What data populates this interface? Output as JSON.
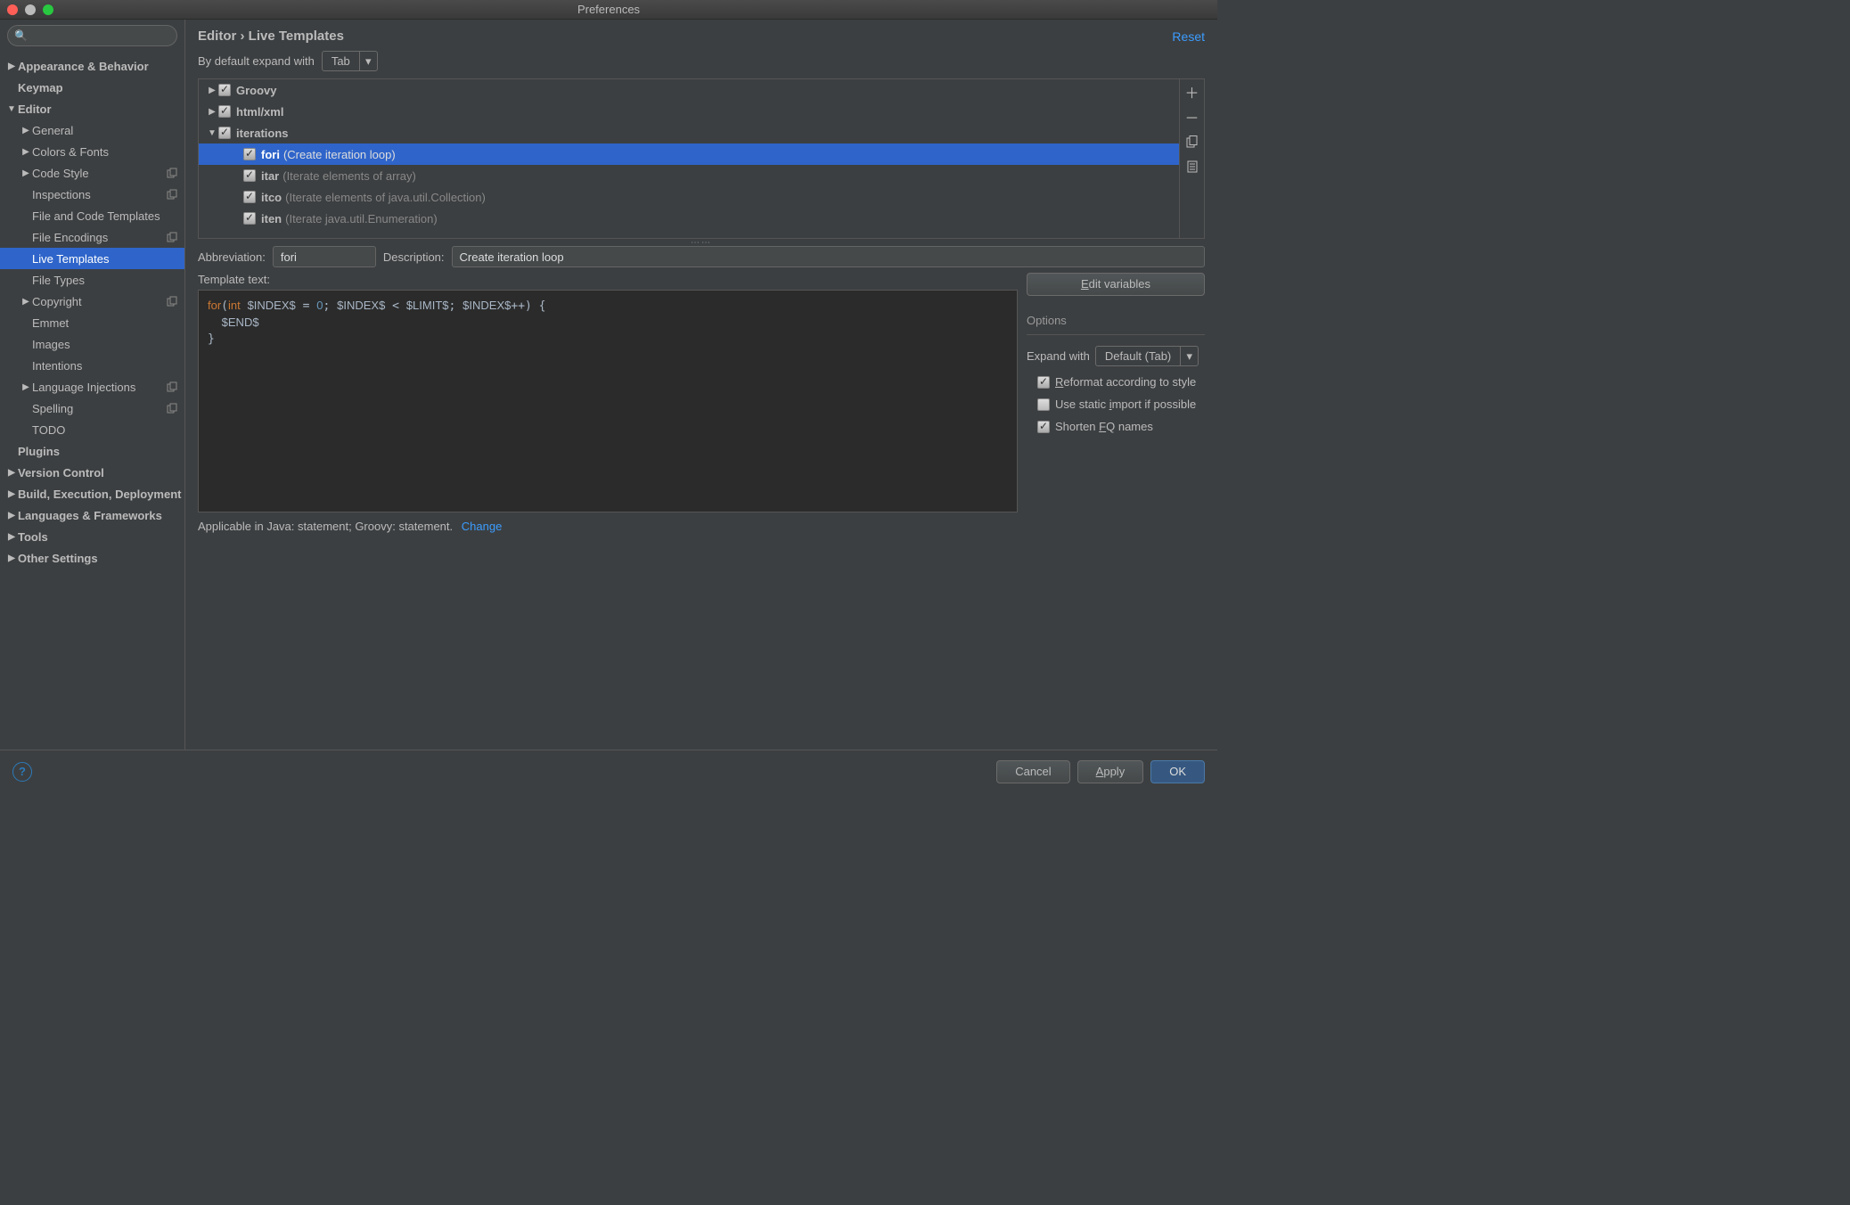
{
  "window": {
    "title": "Preferences"
  },
  "sidebar": {
    "search_placeholder": "",
    "items": [
      {
        "label": "Appearance & Behavior",
        "depth": 0,
        "caret": "right"
      },
      {
        "label": "Keymap",
        "depth": 0,
        "caret": "none"
      },
      {
        "label": "Editor",
        "depth": 0,
        "caret": "down"
      },
      {
        "label": "General",
        "depth": 1,
        "caret": "right"
      },
      {
        "label": "Colors & Fonts",
        "depth": 1,
        "caret": "right"
      },
      {
        "label": "Code Style",
        "depth": 1,
        "caret": "right",
        "suffix": true
      },
      {
        "label": "Inspections",
        "depth": 1,
        "caret": "none",
        "suffix": true
      },
      {
        "label": "File and Code Templates",
        "depth": 1,
        "caret": "none"
      },
      {
        "label": "File Encodings",
        "depth": 1,
        "caret": "none",
        "suffix": true
      },
      {
        "label": "Live Templates",
        "depth": 1,
        "caret": "none",
        "selected": true
      },
      {
        "label": "File Types",
        "depth": 1,
        "caret": "none"
      },
      {
        "label": "Copyright",
        "depth": 1,
        "caret": "right",
        "suffix": true
      },
      {
        "label": "Emmet",
        "depth": 1,
        "caret": "none"
      },
      {
        "label": "Images",
        "depth": 1,
        "caret": "none"
      },
      {
        "label": "Intentions",
        "depth": 1,
        "caret": "none"
      },
      {
        "label": "Language Injections",
        "depth": 1,
        "caret": "right",
        "suffix": true
      },
      {
        "label": "Spelling",
        "depth": 1,
        "caret": "none",
        "suffix": true
      },
      {
        "label": "TODO",
        "depth": 1,
        "caret": "none"
      },
      {
        "label": "Plugins",
        "depth": 0,
        "caret": "none"
      },
      {
        "label": "Version Control",
        "depth": 0,
        "caret": "right"
      },
      {
        "label": "Build, Execution, Deployment",
        "depth": 0,
        "caret": "right"
      },
      {
        "label": "Languages & Frameworks",
        "depth": 0,
        "caret": "right"
      },
      {
        "label": "Tools",
        "depth": 0,
        "caret": "right"
      },
      {
        "label": "Other Settings",
        "depth": 0,
        "caret": "right"
      }
    ]
  },
  "header": {
    "breadcrumb": "Editor › Live Templates",
    "reset": "Reset"
  },
  "expand": {
    "label": "By default expand with",
    "value": "Tab"
  },
  "template_groups": [
    {
      "label": "Groovy",
      "caret": "right",
      "checked": true
    },
    {
      "label": "html/xml",
      "caret": "right",
      "checked": true
    },
    {
      "label": "iterations",
      "caret": "down",
      "checked": true,
      "children": [
        {
          "abbr": "fori",
          "desc": "(Create iteration loop)",
          "checked": true,
          "selected": true
        },
        {
          "abbr": "itar",
          "desc": "(Iterate elements of array)",
          "checked": true
        },
        {
          "abbr": "itco",
          "desc": "(Iterate elements of java.util.Collection)",
          "checked": true
        },
        {
          "abbr": "iten",
          "desc": "(Iterate java.util.Enumeration)",
          "checked": true
        }
      ]
    }
  ],
  "detail": {
    "abbr_label": "Abbreviation:",
    "abbr_value": "fori",
    "desc_label": "Description:",
    "desc_value": "Create iteration loop",
    "template_text_label": "Template text:",
    "edit_vars": "Edit variables",
    "options_label": "Options",
    "expand_with_label": "Expand with",
    "expand_with_value": "Default (Tab)",
    "opt_reformat": "Reformat according to style",
    "opt_static": "Use static import if possible",
    "opt_shorten": "Shorten FQ names",
    "applicable": "Applicable in Java: statement; Groovy: statement.",
    "change": "Change"
  },
  "footer": {
    "cancel": "Cancel",
    "apply": "Apply",
    "ok": "OK"
  }
}
